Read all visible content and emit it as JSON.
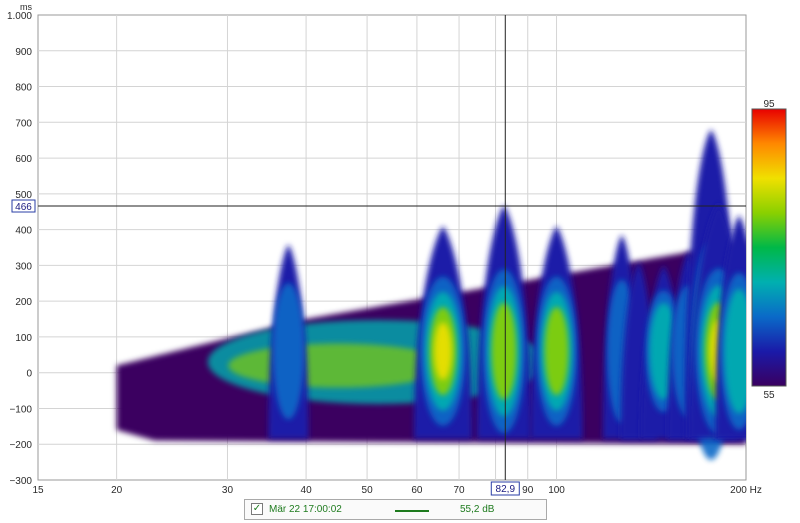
{
  "chart_data": {
    "type": "heatmap",
    "subtype": "spectrogram",
    "x_unit": "Hz",
    "y_unit": "ms",
    "x_scale": "log",
    "xlim": [
      15,
      200
    ],
    "ylim": [
      -300,
      1000
    ],
    "x_ticks": [
      "15",
      "20",
      "30",
      "40",
      "50",
      "60",
      "70",
      "80",
      "90",
      "100",
      "200 Hz"
    ],
    "x_tick_values": [
      15,
      20,
      30,
      40,
      50,
      60,
      70,
      80,
      90,
      100,
      200
    ],
    "y_ticks": [
      "1.000",
      "900",
      "800",
      "700",
      "600",
      "500",
      "400",
      "300",
      "200",
      "100",
      "0",
      "−100",
      "−200",
      "−300"
    ],
    "y_tick_values": [
      1000,
      900,
      800,
      700,
      600,
      500,
      400,
      300,
      200,
      100,
      0,
      -100,
      -200,
      -300
    ],
    "grid": true,
    "cursor": {
      "x": 82.9,
      "x_label": "82,9",
      "y": 466,
      "y_label": "466"
    },
    "colorbar": {
      "min": 55,
      "max": 95,
      "min_label": "55",
      "max_label": "95",
      "colors": [
        "#3a0060",
        "#1a1aa8",
        "#0a6ac8",
        "#00b0b0",
        "#00b848",
        "#8ad000",
        "#f0e000",
        "#ff8800",
        "#e80000"
      ]
    },
    "low_frequency_cutoff_hz": 20,
    "band": {
      "bottom_ms": -200,
      "top_start_ms": 20,
      "top_at_40hz_ms": 150,
      "top_at_65hz_ms": 215
    },
    "peaks": [
      {
        "freq_hz": 37.5,
        "top_ms": 358,
        "intensity": 68
      },
      {
        "freq_hz": 66,
        "top_ms": 410,
        "intensity": 86
      },
      {
        "freq_hz": 82.5,
        "top_ms": 468,
        "intensity": 82
      },
      {
        "freq_hz": 100,
        "top_ms": 410,
        "intensity": 80
      },
      {
        "freq_hz": 127,
        "top_ms": 385,
        "intensity": 66
      },
      {
        "freq_hz": 135,
        "top_ms": 310,
        "intensity": 64
      },
      {
        "freq_hz": 148,
        "top_ms": 300,
        "intensity": 74
      },
      {
        "freq_hz": 162,
        "top_ms": 340,
        "intensity": 70
      },
      {
        "freq_hz": 176,
        "top_ms": 680,
        "intensity": 80
      },
      {
        "freq_hz": 181,
        "top_ms": 475,
        "intensity": 88
      },
      {
        "freq_hz": 195,
        "top_ms": 440,
        "intensity": 76
      }
    ]
  },
  "legend": {
    "checked": "✓",
    "label": "Mär 22 17:00:02",
    "color": "#1e7b1e",
    "value": "55,2 dB"
  }
}
